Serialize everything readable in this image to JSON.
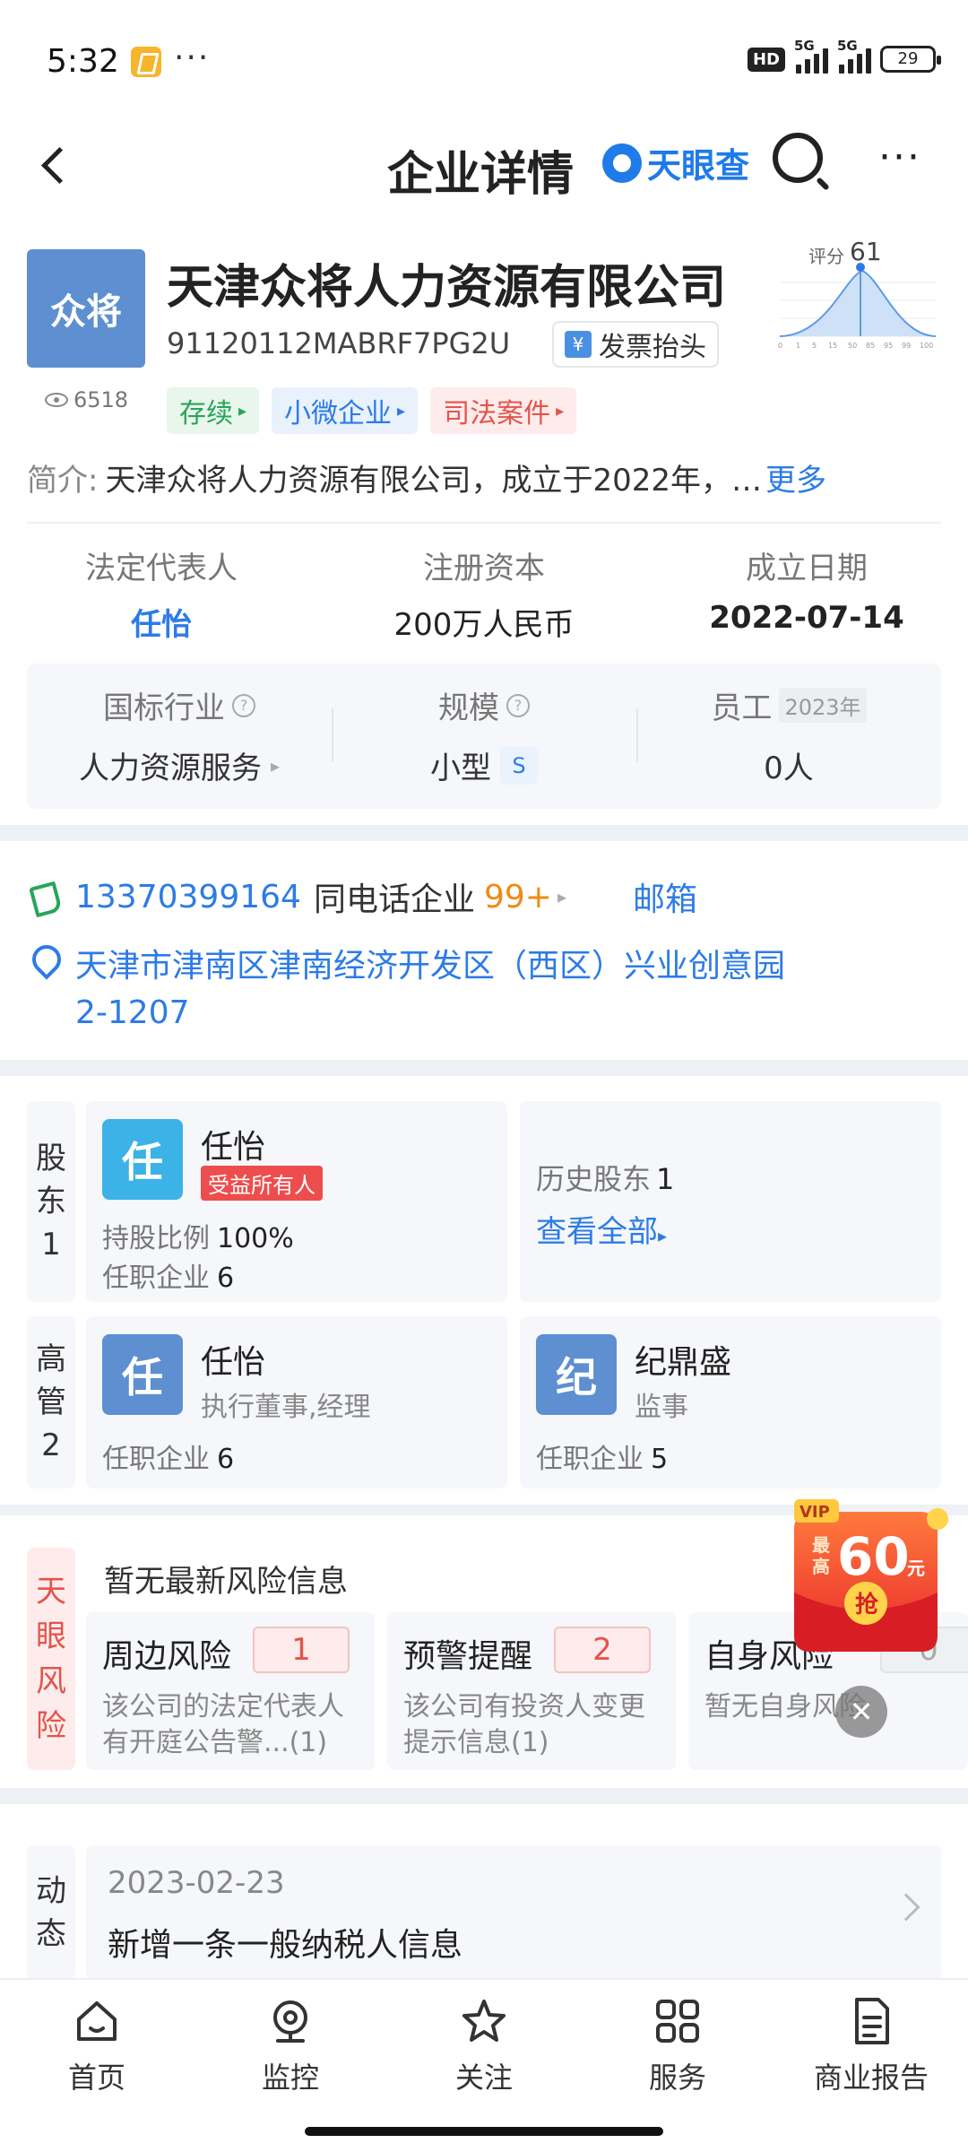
{
  "status_bar": {
    "time": "5:32",
    "dots": "···",
    "hd": "HD",
    "net1": "5G",
    "net2": "5G",
    "battery": "29"
  },
  "header": {
    "title": "企业详情",
    "brand": "天眼查"
  },
  "company": {
    "logo_text": "众将",
    "views": "6518",
    "name": "天津众将人力资源有限公司",
    "credit_code": "91120112MABRF7PG2U",
    "invoice_label": "发票抬头",
    "score_label": "评分",
    "score": "61",
    "score_axis": [
      "0",
      "1",
      "5",
      "15",
      "50",
      "85",
      "95",
      "99",
      "100"
    ],
    "tags": [
      "存续",
      "小微企业",
      "司法案件"
    ],
    "intro_label": "简介:",
    "intro_text": "天津众将人力资源有限公司，成立于2022年，…",
    "intro_more": "更多",
    "legal_rep_label": "法定代表人",
    "legal_rep": "任怡",
    "capital_label": "注册资本",
    "capital": "200万人民币",
    "founded_label": "成立日期",
    "founded": "2022-07-14",
    "industry_label": "国标行业",
    "industry": "人力资源服务",
    "scale_label": "规模",
    "scale": "小型",
    "scale_badge": "S",
    "employees_label": "员工",
    "employees_year": "2023年",
    "employees": "0人"
  },
  "contact": {
    "phone": "13370399164",
    "same_phone_label": "同电话企业",
    "same_phone_count": "99+",
    "email_label": "邮箱",
    "address_line1": "天津市津南区津南经济开发区（西区）兴业创意园",
    "address_line2": "2-1207"
  },
  "shareholders": {
    "side_label": [
      "股",
      "东",
      "1"
    ],
    "holder": {
      "avatar": "任",
      "name": "任怡",
      "badge": "受益所有人",
      "ratio_label": "持股比例",
      "ratio": "100%",
      "positions_label": "任职企业",
      "positions": "6"
    },
    "history_label": "历史股东",
    "history_count": "1",
    "view_all": "查看全部"
  },
  "executives": {
    "side_label": [
      "高",
      "管",
      "2"
    ],
    "list": [
      {
        "avatar": "任",
        "name": "任怡",
        "role": "执行董事,经理",
        "positions_label": "任职企业",
        "positions": "6"
      },
      {
        "avatar": "纪",
        "name": "纪鼎盛",
        "role": "监事",
        "positions_label": "任职企业",
        "positions": "5"
      }
    ]
  },
  "risk": {
    "side_label": [
      "天",
      "眼",
      "风",
      "险"
    ],
    "title": "暂无最新风险信息",
    "cards": [
      {
        "title": "周边风险",
        "count": "1",
        "desc": "该公司的法定代表人有开庭公告警...(1)"
      },
      {
        "title": "预警提醒",
        "count": "2",
        "desc": "该公司有投资人变更提示信息(1)"
      },
      {
        "title": "自身风险",
        "count": "0",
        "desc": "暂无自身风险"
      }
    ]
  },
  "dynamics": {
    "side_label": [
      "动",
      "态"
    ],
    "date": "2023-02-23",
    "text": "新增一条一般纳税人信息"
  },
  "promo": {
    "vip": "VIP",
    "line1": "最",
    "line2": "高",
    "amount": "60",
    "unit": "元",
    "grab": "抢"
  },
  "tabs": [
    {
      "label": "首页",
      "icon": "home-icon"
    },
    {
      "label": "监控",
      "icon": "monitor-icon"
    },
    {
      "label": "关注",
      "icon": "star-icon"
    },
    {
      "label": "服务",
      "icon": "grid-icon"
    },
    {
      "label": "商业报告",
      "icon": "report-icon"
    }
  ]
}
